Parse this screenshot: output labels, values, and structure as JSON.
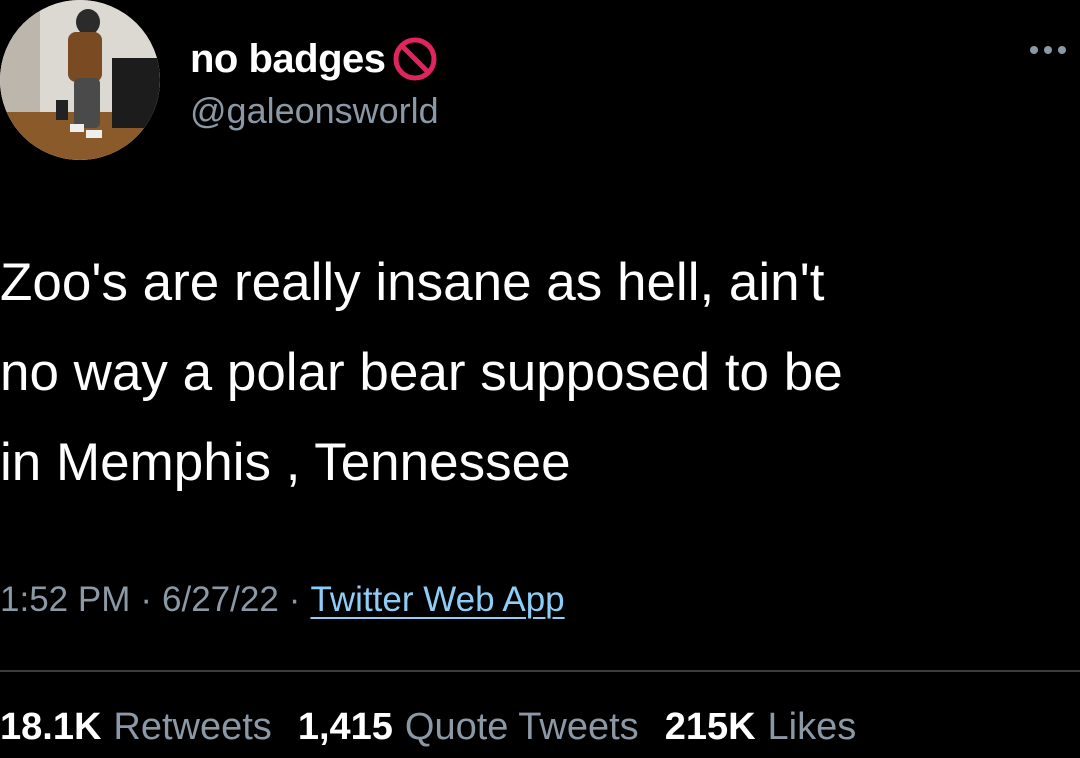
{
  "author": {
    "display_name": "no badges",
    "badge_icon": "no-entry-icon",
    "handle": "@galeonsworld"
  },
  "tweet": {
    "text": "Zoo's are really insane as hell, ain't\nno way a polar bear supposed to be\nin Memphis , Tennessee",
    "time": "1:52 PM",
    "date": "6/27/22",
    "separator": "·",
    "source": "Twitter Web App"
  },
  "stats": {
    "retweets_count": "18.1K",
    "retweets_label": "Retweets",
    "quotes_count": "1,415",
    "quotes_label": "Quote Tweets",
    "likes_count": "215K",
    "likes_label": "Likes"
  },
  "colors": {
    "background": "#000000",
    "primary_text": "#ffffff",
    "secondary_text": "#8b98a5",
    "link": "#8ecdf8",
    "badge_red": "#e0245e"
  }
}
